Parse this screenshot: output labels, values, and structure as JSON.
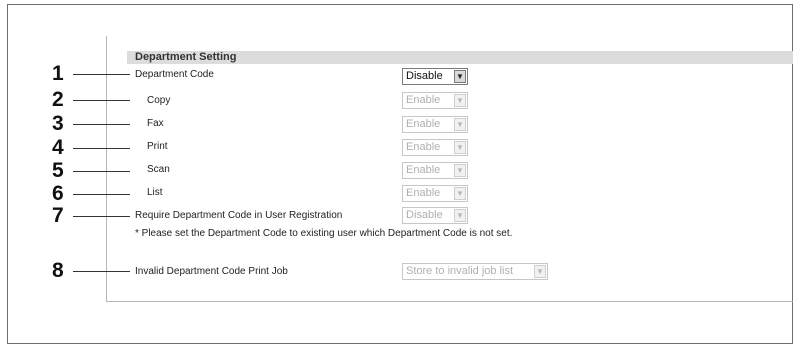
{
  "section": {
    "title": "Department Setting"
  },
  "rows": [
    {
      "callout": "1",
      "label": "Department Code",
      "value": "Disable",
      "enabled": true
    },
    {
      "callout": "2",
      "label": "Copy",
      "value": "Enable",
      "enabled": false
    },
    {
      "callout": "3",
      "label": "Fax",
      "value": "Enable",
      "enabled": false
    },
    {
      "callout": "4",
      "label": "Print",
      "value": "Enable",
      "enabled": false
    },
    {
      "callout": "5",
      "label": "Scan",
      "value": "Enable",
      "enabled": false
    },
    {
      "callout": "6",
      "label": "List",
      "value": "Enable",
      "enabled": false
    },
    {
      "callout": "7",
      "label": "Require Department Code in User Registration",
      "value": "Disable",
      "enabled": false
    },
    {
      "callout": "8",
      "label": "Invalid Department Code Print Job",
      "value": "Store to invalid job list",
      "enabled": false
    }
  ],
  "note": "* Please set the Department Code to existing user which Department Code is not set.",
  "icons": {
    "dropdown": "chevron-down-icon"
  }
}
